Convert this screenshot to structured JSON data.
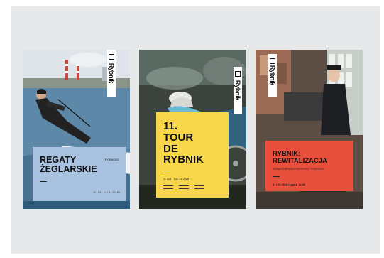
{
  "posters": [
    {
      "brand": "Rybnik",
      "title_lines": [
        "REGATY",
        "ŻEGLARSKIE"
      ],
      "tag": "RYBNICKIE",
      "dates": "11 / 24 - 14 / 24 2018 r.",
      "block_color": "#a8c2e0"
    },
    {
      "brand": "Rybnik",
      "title_lines": [
        "11.",
        "TOUR",
        "DE",
        "RYBNIK"
      ],
      "dates": "11 / 24 - 14 / 24 2018 r.",
      "block_color": "#f7d64b"
    },
    {
      "brand": "Rybnik",
      "title_lines": [
        "RYBNIK:",
        "REWITALIZACJA"
      ],
      "subtitle": "NOWA ENERGIA  POKONTKIJ  TRADYCJI",
      "dates": "01 / 06 2018 r.  godz. 12.00",
      "block_color": "#e84f3d"
    }
  ]
}
